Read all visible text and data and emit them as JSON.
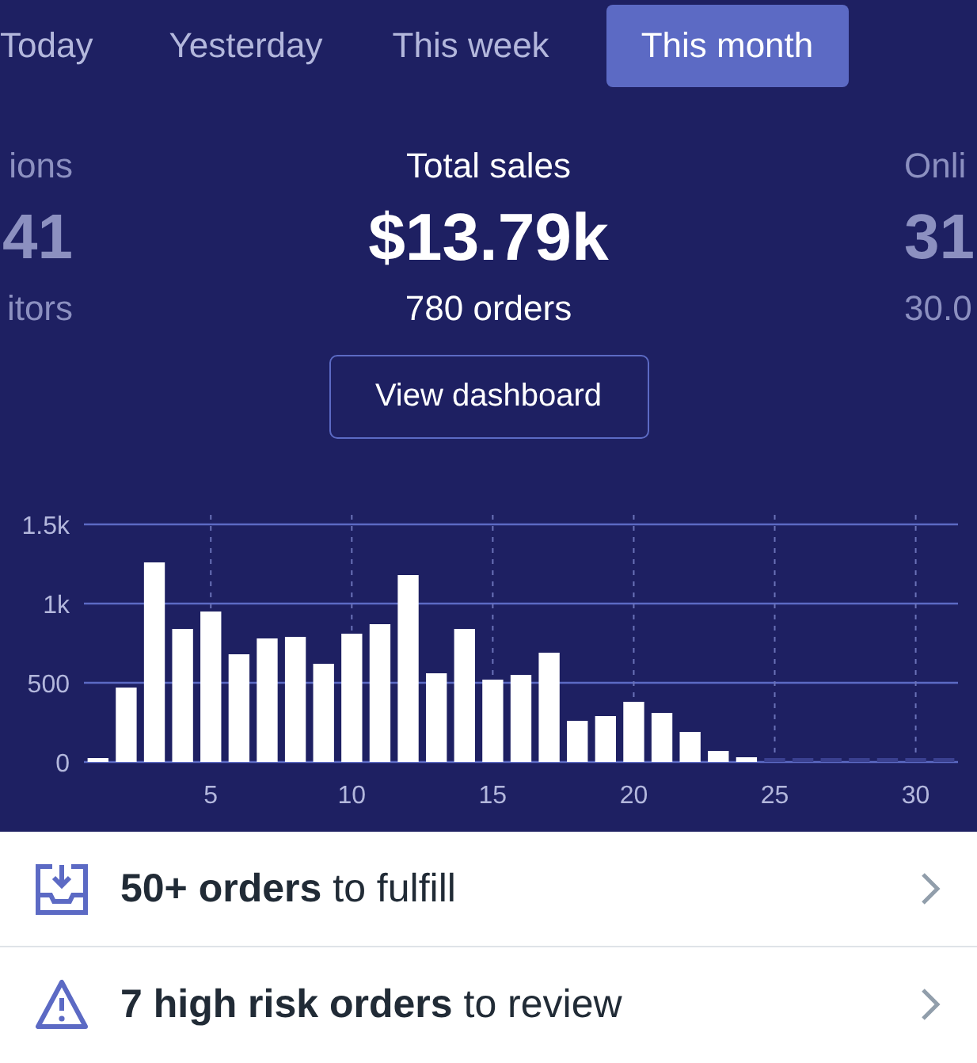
{
  "tabs": [
    {
      "label": "Today",
      "selected": false
    },
    {
      "label": "Yesterday",
      "selected": false
    },
    {
      "label": "This week",
      "selected": false
    },
    {
      "label": "This month",
      "selected": true
    }
  ],
  "stats": [
    {
      "label": "ions",
      "value": "41",
      "sub": "itors",
      "kind": "side"
    },
    {
      "label": "Total sales",
      "value": "$13.79k",
      "sub": "780 orders",
      "kind": "main"
    },
    {
      "label": "Onli",
      "value": "31",
      "sub": "30.0",
      "kind": "side"
    }
  ],
  "dashboard_button": "View dashboard",
  "sales_chart": {
    "chart_data": {
      "type": "bar",
      "x": [
        1,
        2,
        3,
        4,
        5,
        6,
        7,
        8,
        9,
        10,
        11,
        12,
        13,
        14,
        15,
        16,
        17,
        18,
        19,
        20,
        21,
        22,
        23,
        24,
        25,
        26,
        27,
        28,
        29,
        30,
        31
      ],
      "values": [
        20,
        470,
        1260,
        840,
        950,
        680,
        780,
        790,
        620,
        810,
        870,
        1180,
        560,
        840,
        520,
        550,
        690,
        260,
        290,
        380,
        310,
        190,
        70,
        30,
        0,
        0,
        0,
        0,
        0,
        0,
        0
      ],
      "xlim": [
        0.5,
        31.5
      ],
      "ylim": [
        0,
        1500
      ],
      "grid": true,
      "yticks": [
        {
          "value": 0,
          "label": "0"
        },
        {
          "value": 500,
          "label": "500"
        },
        {
          "value": 1000,
          "label": "1k"
        },
        {
          "value": 1500,
          "label": "1.5k"
        }
      ],
      "xticks": [
        5,
        10,
        15,
        20,
        25,
        30
      ]
    }
  },
  "tasks": [
    {
      "text": "**50+ orders** to fulfill",
      "kind": "fulfill"
    },
    {
      "text": "**7 high risk orders** to review",
      "kind": "risk"
    }
  ]
}
